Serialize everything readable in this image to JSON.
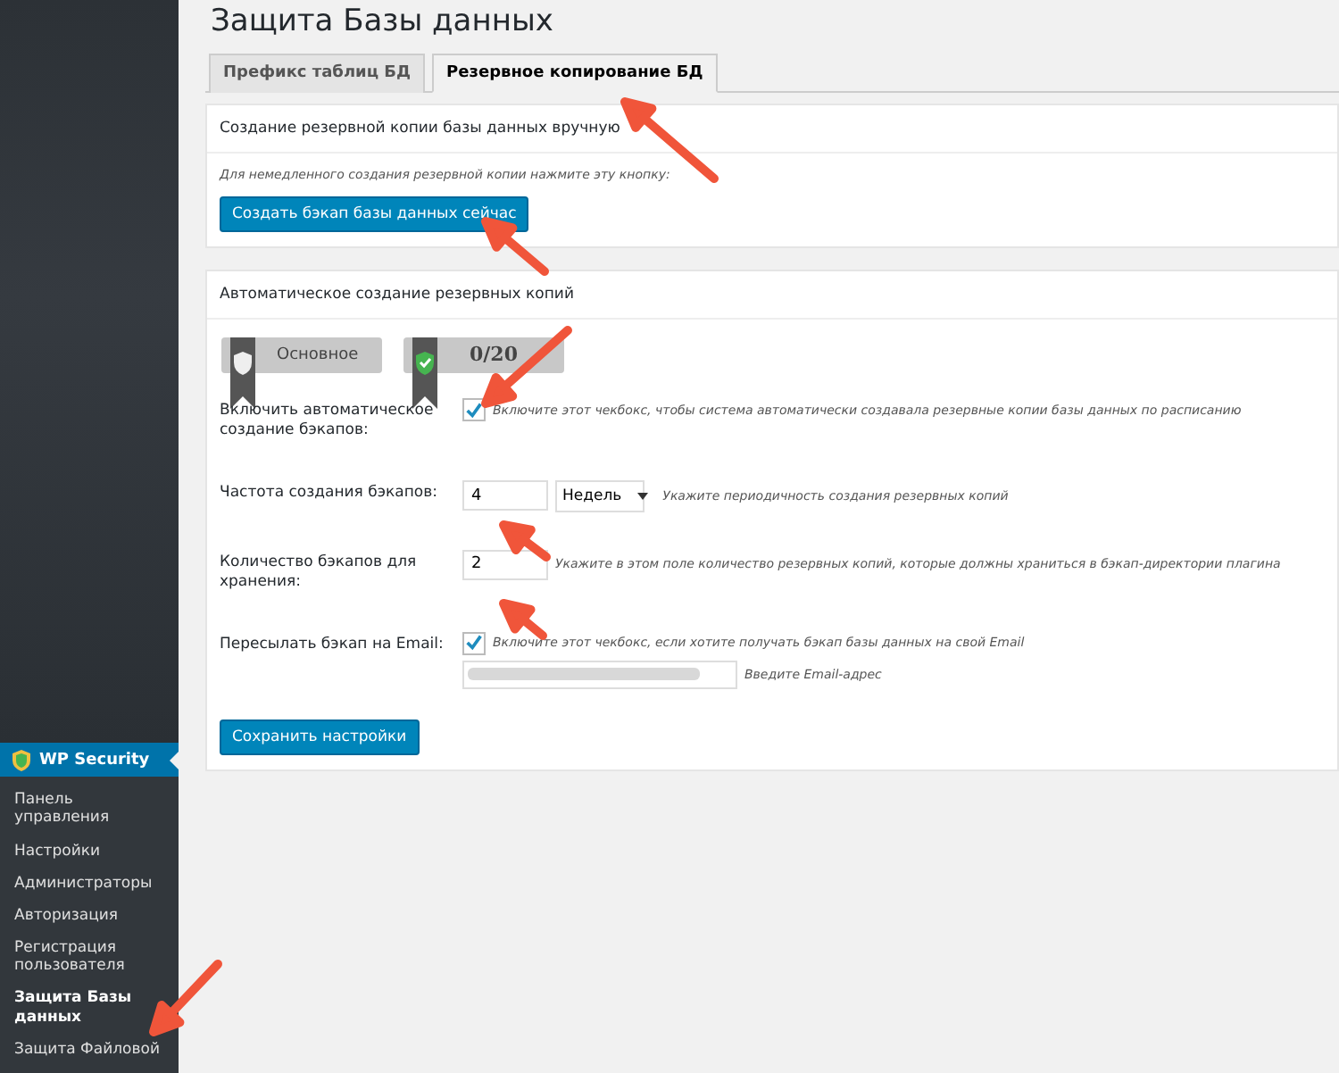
{
  "page_title": "Защита Базы данных",
  "tabs": [
    {
      "label": "Префикс таблиц БД",
      "selected": false
    },
    {
      "label": "Резервное копирование БД",
      "selected": true
    }
  ],
  "manual_backup": {
    "heading": "Создание резервной копии базы данных вручную",
    "description": "Для немедленного создания резервной копии нажмите эту кнопку:",
    "button": "Создать бэкап базы данных сейчас"
  },
  "auto_backup": {
    "heading": "Автоматическое создание резервных копий",
    "badges": [
      {
        "kind": "shield",
        "label": "Основное"
      },
      {
        "kind": "check-shield",
        "label": "0/20"
      }
    ],
    "fields": [
      {
        "kind": "checkbox",
        "label": "Включить автоматическое создание бэкапов:",
        "checked": true,
        "hint": "Включите этот чекбокс, чтобы система автоматически создавала резервные копии базы данных по расписанию"
      },
      {
        "kind": "number-select",
        "label": "Частота создания бэкапов:",
        "value": "4",
        "select": "Недель",
        "hint": "Укажите периодичность создания резервных копий"
      },
      {
        "kind": "number",
        "label": "Количество бэкапов для хранения:",
        "value": "2",
        "hint": "Укажите в этом поле количество резервных копий, которые должны храниться в бэкап-директории плагина"
      },
      {
        "kind": "checkbox-email",
        "label": "Пересылать бэкап на Email:",
        "checked": true,
        "hint": "Включите этот чекбокс, если хотите получать бэкап базы данных на свой Email",
        "email_hint": "Введите Email-адрес"
      }
    ],
    "save_button": "Сохранить настройки"
  },
  "sidebar": {
    "plugin": "WP Security",
    "items": [
      {
        "label": "Панель управления",
        "selected": false
      },
      {
        "label": "Настройки",
        "selected": false
      },
      {
        "label": "Администраторы",
        "selected": false
      },
      {
        "label": "Авторизация",
        "selected": false
      },
      {
        "label": "Регистрация пользователя",
        "selected": false
      },
      {
        "label": "Защита Базы данных",
        "selected": true
      },
      {
        "label": "Защита Файловой",
        "selected": false
      }
    ]
  }
}
